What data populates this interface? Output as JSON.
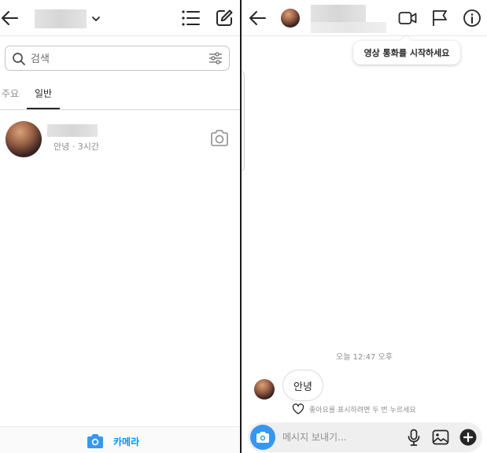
{
  "inbox": {
    "search": {
      "placeholder": "검색"
    },
    "tabs": [
      {
        "label": "주요",
        "active": false
      },
      {
        "label": "일반",
        "active": true
      }
    ],
    "threads": [
      {
        "preview": "안녕 · 3시간"
      }
    ],
    "bottom": {
      "camera_label": "카메라"
    }
  },
  "chat": {
    "tooltip": "영상 통화를 시작하세요",
    "timestamp": "오늘 12:47 오후",
    "messages": [
      {
        "text": "안녕",
        "from": "other"
      }
    ],
    "like_hint": "좋아요를 표시하려면 두 번 누르세요",
    "composer": {
      "placeholder": "메시지 보내기..."
    }
  },
  "colors": {
    "accent": "#0095f6",
    "camera_button": "#3797f0",
    "text_primary": "#262626",
    "text_secondary": "#8e8e8e"
  },
  "icons": [
    "back-arrow-icon",
    "chevron-down-icon",
    "list-icon",
    "compose-icon",
    "search-icon",
    "filter-icon",
    "camera-icon",
    "video-call-icon",
    "flag-icon",
    "info-icon",
    "heart-icon",
    "mic-icon",
    "gallery-icon",
    "plus-icon"
  ]
}
